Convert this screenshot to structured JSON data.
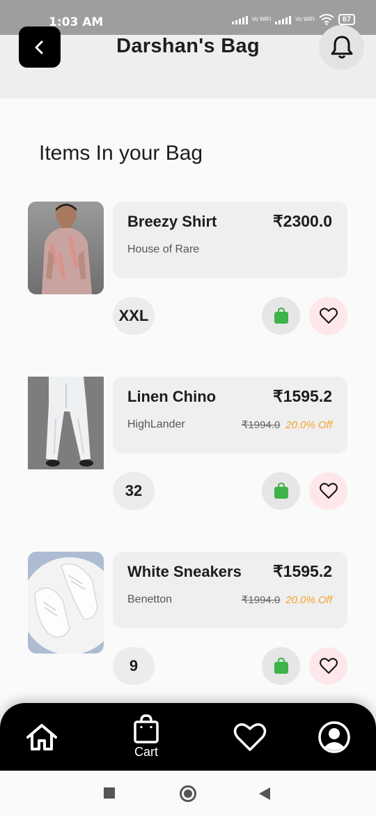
{
  "status_bar": {
    "time": "1:03 AM",
    "network_label": "Vo WiFi",
    "battery": "87"
  },
  "header": {
    "title": "Darshan's Bag"
  },
  "section": {
    "title": "Items In your Bag"
  },
  "items": [
    {
      "name": "Breezy Shirt",
      "brand": "House of Rare",
      "price": "₹2300.0",
      "mrp": "",
      "discount": "",
      "size": "XXL"
    },
    {
      "name": "Linen Chino",
      "brand": "HighLander",
      "price": "₹1595.2",
      "mrp": "₹1994.0",
      "discount": "20.0% Off",
      "size": "32"
    },
    {
      "name": "White Sneakers",
      "brand": "Benetton",
      "price": "₹1595.2",
      "mrp": "₹1994.0",
      "discount": "20.0% Off",
      "size": "9"
    }
  ],
  "bottom_nav": {
    "cart_label": "Cart",
    "icons": [
      "home-icon",
      "bag-icon",
      "heart-icon",
      "profile-icon"
    ]
  },
  "colors": {
    "accent_black": "#000000",
    "bag_green": "#3db34a",
    "favorite_bg": "#fde7ea",
    "discount_orange": "#f4a42b"
  }
}
